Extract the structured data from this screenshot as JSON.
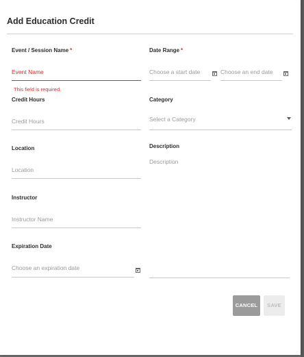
{
  "dialog": {
    "title": "Add Education Credit",
    "buttons": {
      "cancel": "CANCEL",
      "save": "SAVE"
    }
  },
  "form": {
    "event_name": {
      "label": "Event / Session Name",
      "required_mark": "*",
      "placeholder": "Event Name",
      "error": "This field is required."
    },
    "date_range": {
      "label": "Date Range",
      "required_mark": "*",
      "start_placeholder": "Choose a start date",
      "end_placeholder": "Choose an end date"
    },
    "credit_hours": {
      "label": "Credit Hours",
      "placeholder": "Credit Hours"
    },
    "category": {
      "label": "Category",
      "placeholder": "Select a Category"
    },
    "location": {
      "label": "Location",
      "placeholder": "Location"
    },
    "description": {
      "label": "Description",
      "placeholder": "Description"
    },
    "instructor": {
      "label": "Instructor",
      "placeholder": "Instructor Name"
    },
    "expiration_date": {
      "label": "Expiration Date",
      "placeholder": "Choose an expiration date"
    }
  },
  "icons": [
    "calendar-icon",
    "dropdown-caret-icon"
  ],
  "colors": {
    "error": "#d32f2f",
    "cancel_bg": "#9b9b9b",
    "save_bg": "#ececec"
  }
}
